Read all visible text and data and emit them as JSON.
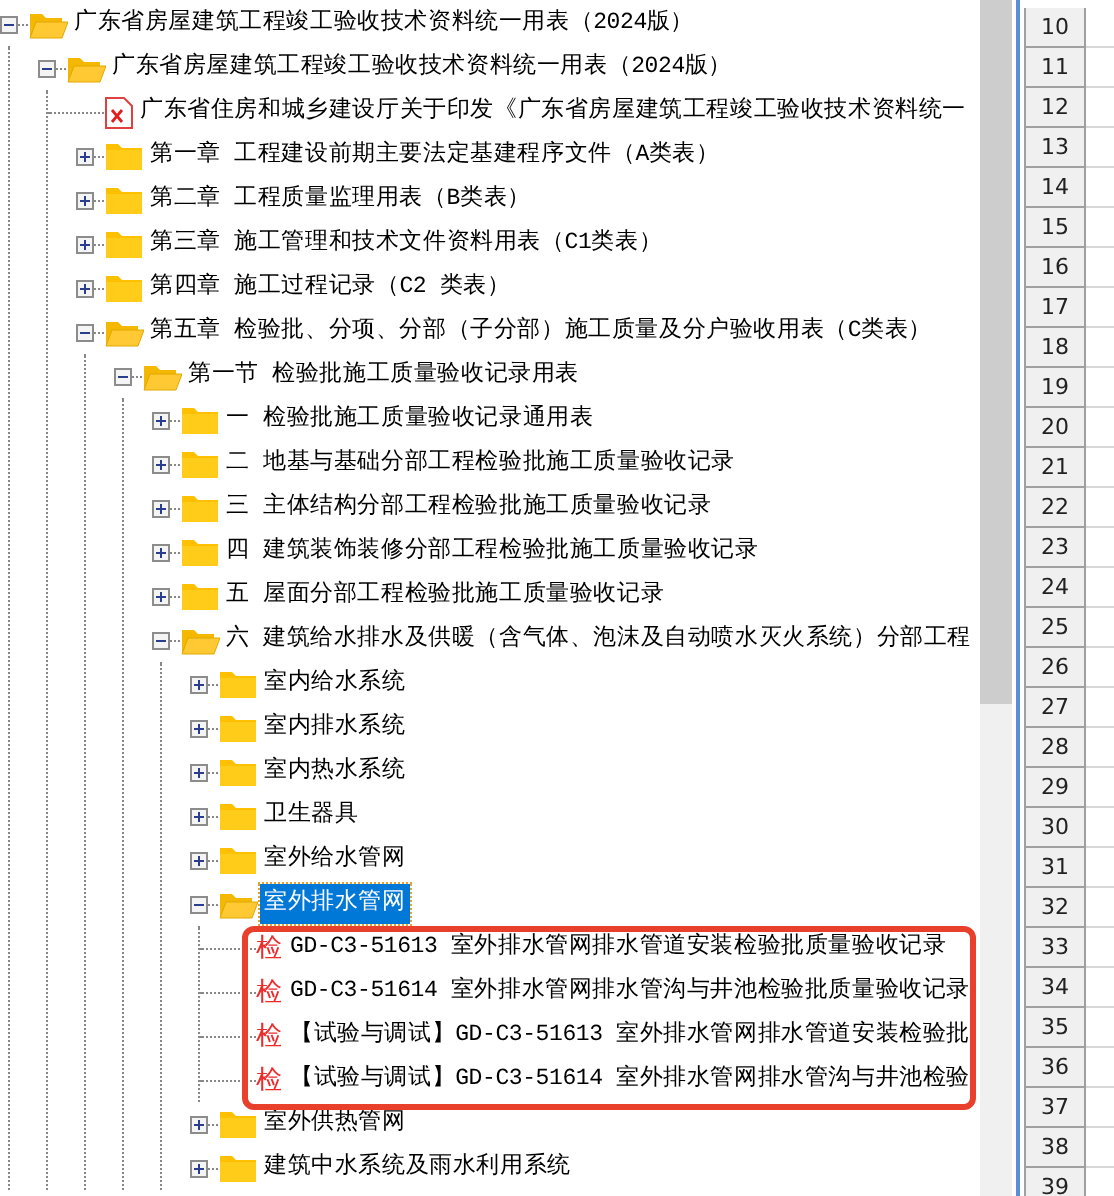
{
  "tree": [
    {
      "kind": "folder",
      "label": "广东省房屋建筑工程竣工验收技术资料统一用表（2024版）",
      "expanded": true,
      "selected": false,
      "children": [
        {
          "kind": "folder",
          "label": "广东省房屋建筑工程竣工验收技术资料统一用表（2024版）",
          "expanded": true,
          "selected": false,
          "children": [
            {
              "kind": "document",
              "label": "广东省住房和城乡建设厅关于印发《广东省房屋建筑工程竣工验收技术资料统一",
              "selected": false
            },
            {
              "kind": "folder",
              "label": "第一章 工程建设前期主要法定基建程序文件（A类表）",
              "expanded": false,
              "selected": false
            },
            {
              "kind": "folder",
              "label": "第二章 工程质量监理用表（B类表）",
              "expanded": false,
              "selected": false
            },
            {
              "kind": "folder",
              "label": "第三章 施工管理和技术文件资料用表（C1类表）",
              "expanded": false,
              "selected": false
            },
            {
              "kind": "folder",
              "label": "第四章 施工过程记录（C2 类表）",
              "expanded": false,
              "selected": false
            },
            {
              "kind": "folder",
              "label": "第五章 检验批、分项、分部（子分部）施工质量及分户验收用表（C类表）",
              "expanded": true,
              "selected": false,
              "children": [
                {
                  "kind": "folder",
                  "label": "第一节 检验批施工质量验收记录用表",
                  "expanded": true,
                  "selected": false,
                  "children": [
                    {
                      "kind": "folder",
                      "label": "一 检验批施工质量验收记录通用表",
                      "expanded": false,
                      "selected": false
                    },
                    {
                      "kind": "folder",
                      "label": "二 地基与基础分部工程检验批施工质量验收记录",
                      "expanded": false,
                      "selected": false
                    },
                    {
                      "kind": "folder",
                      "label": "三 主体结构分部工程检验批施工质量验收记录",
                      "expanded": false,
                      "selected": false
                    },
                    {
                      "kind": "folder",
                      "label": "四 建筑装饰装修分部工程检验批施工质量验收记录",
                      "expanded": false,
                      "selected": false
                    },
                    {
                      "kind": "folder",
                      "label": "五 屋面分部工程检验批施工质量验收记录",
                      "expanded": false,
                      "selected": false
                    },
                    {
                      "kind": "folder",
                      "label": "六 建筑给水排水及供暖（含气体、泡沫及自动喷水灭火系统）分部工程",
                      "expanded": true,
                      "selected": false,
                      "children": [
                        {
                          "kind": "folder",
                          "label": "室内给水系统",
                          "expanded": false,
                          "selected": false
                        },
                        {
                          "kind": "folder",
                          "label": "室内排水系统",
                          "expanded": false,
                          "selected": false
                        },
                        {
                          "kind": "folder",
                          "label": "室内热水系统",
                          "expanded": false,
                          "selected": false
                        },
                        {
                          "kind": "folder",
                          "label": "卫生器具",
                          "expanded": false,
                          "selected": false
                        },
                        {
                          "kind": "folder",
                          "label": "室外给水管网",
                          "expanded": false,
                          "selected": false
                        },
                        {
                          "kind": "folder",
                          "label": "室外排水管网",
                          "expanded": true,
                          "selected": true,
                          "children": [
                            {
                              "kind": "form",
                              "glyph": "检",
                              "label": "GD-C3-51613 室外排水管网排水管道安装检验批质量验收记录",
                              "selected": false
                            },
                            {
                              "kind": "form",
                              "glyph": "检",
                              "label": "GD-C3-51614 室外排水管网排水管沟与井池检验批质量验收记录",
                              "selected": false
                            },
                            {
                              "kind": "form",
                              "glyph": "检",
                              "label": "【试验与调试】GD-C3-51613 室外排水管网排水管道安装检验批",
                              "selected": false
                            },
                            {
                              "kind": "form",
                              "glyph": "检",
                              "label": "【试验与调试】GD-C3-51614 室外排水管网排水管沟与井池检验",
                              "selected": false
                            }
                          ]
                        },
                        {
                          "kind": "folder",
                          "label": "室外供热管网",
                          "expanded": false,
                          "selected": false
                        },
                        {
                          "kind": "folder",
                          "label": "建筑中水系统及雨水利用系统",
                          "expanded": false,
                          "selected": false
                        }
                      ]
                    }
                  ]
                }
              ]
            }
          ]
        }
      ]
    }
  ],
  "spreadsheet": {
    "row_headers": [
      "10",
      "11",
      "12",
      "13",
      "14",
      "15",
      "16",
      "17",
      "18",
      "19",
      "20",
      "21",
      "22",
      "23",
      "24",
      "25",
      "26",
      "27",
      "28",
      "29",
      "30",
      "31",
      "32",
      "33",
      "34",
      "35",
      "36",
      "37",
      "38",
      "39"
    ]
  }
}
